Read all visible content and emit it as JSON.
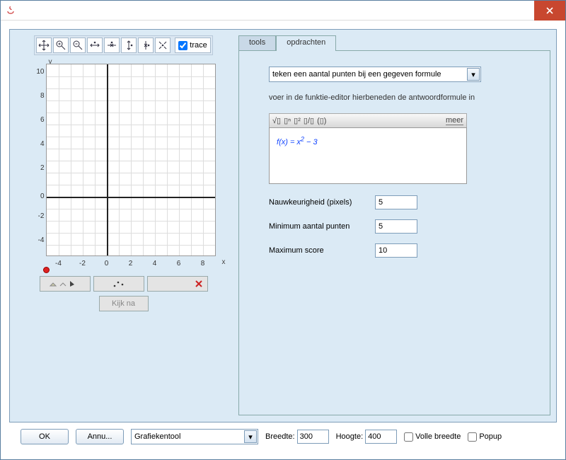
{
  "window": {
    "close_aria": "Close"
  },
  "graph": {
    "trace_label": "trace",
    "y_ticks": [
      10,
      8,
      6,
      4,
      2,
      0,
      -2,
      -4
    ],
    "x_ticks": [
      -4,
      -2,
      0,
      2,
      4,
      6,
      8
    ],
    "x_axis_label": "x",
    "y_axis_label": "y",
    "kijkna_label": "Kijk na",
    "tools": [
      "move-icon",
      "zoom-in-icon",
      "zoom-out-icon",
      "pan-nw-icon",
      "pan-ne-icon",
      "pan-sw-icon",
      "pan-se-icon",
      "pan-out-icon"
    ]
  },
  "tabs": {
    "tools_label": "tools",
    "opdrachten_label": "opdrachten",
    "active": "opdrachten"
  },
  "opdracht": {
    "dropdown_value": "teken een aantal punten bij een gegeven formule",
    "instruction": "voer in de funktie-editor hierbeneden de antwoordformule in",
    "formula_toolbar_items": [
      "√▯",
      "▯ⁿ",
      "▯²",
      "▯/▯",
      "(▯)",
      "meer"
    ],
    "formula_display": "f(x) = x² − 3",
    "params": {
      "nauwkeurigheid_label": "Nauwkeurigheid (pixels)",
      "nauwkeurigheid_value": "5",
      "min_punten_label": "Minimum aantal punten",
      "min_punten_value": "5",
      "max_score_label": "Maximum score",
      "max_score_value": "10"
    }
  },
  "bottom": {
    "ok_label": "OK",
    "cancel_label": "Annu...",
    "tool_select_value": "Grafiekentool",
    "breedte_label": "Breedte:",
    "breedte_value": "300",
    "hoogte_label": "Hoogte:",
    "hoogte_value": "400",
    "volle_breedte_label": "Volle breedte",
    "popup_label": "Popup"
  },
  "chart_data": {
    "type": "line",
    "title": "",
    "xlabel": "x",
    "ylabel": "y",
    "xlim": [
      -5,
      9
    ],
    "ylim": [
      -5,
      11
    ],
    "x_ticks": [
      -4,
      -2,
      0,
      2,
      4,
      6,
      8
    ],
    "y_ticks": [
      -4,
      -2,
      0,
      2,
      4,
      6,
      8,
      10
    ],
    "series": [],
    "annotations": [
      {
        "type": "point",
        "x": -5,
        "y": -5,
        "color": "#d22"
      }
    ],
    "grid": true
  }
}
